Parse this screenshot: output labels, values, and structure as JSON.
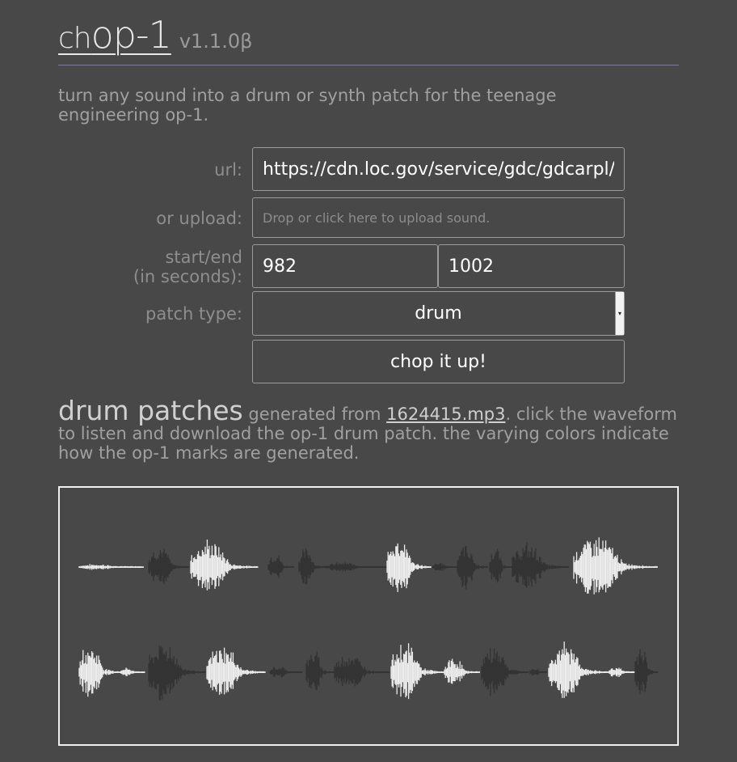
{
  "header": {
    "brand_prefix": "ch",
    "brand_main": "op-1",
    "version": "v1.1.0β"
  },
  "intro": "turn any sound into a drum or synth patch for the teenage engineering op-1.",
  "form": {
    "url_label": "url:",
    "url_value": "https://cdn.loc.gov/service/gdc/gdcarpl/",
    "upload_label": "or upload:",
    "upload_placeholder": "Drop or click here to upload sound.",
    "startend_label_1": "start/end",
    "startend_label_2": "(in seconds):",
    "start_value": "982",
    "end_value": "1002",
    "patch_type_label": "patch type:",
    "patch_type_value": "drum",
    "submit_label": "chop it up!"
  },
  "results": {
    "heading": "drum patches",
    "text_before": "generated from",
    "filename": "1624415.mp3",
    "text_after": ". click the waveform to listen and download the op-1 drum patch. the varying colors indicate how the op-1 marks are generated."
  },
  "colors": {
    "background": "#484848",
    "wave_light": "#ececec",
    "wave_dark": "#333333",
    "accent_rule": "#7b7bb0"
  }
}
